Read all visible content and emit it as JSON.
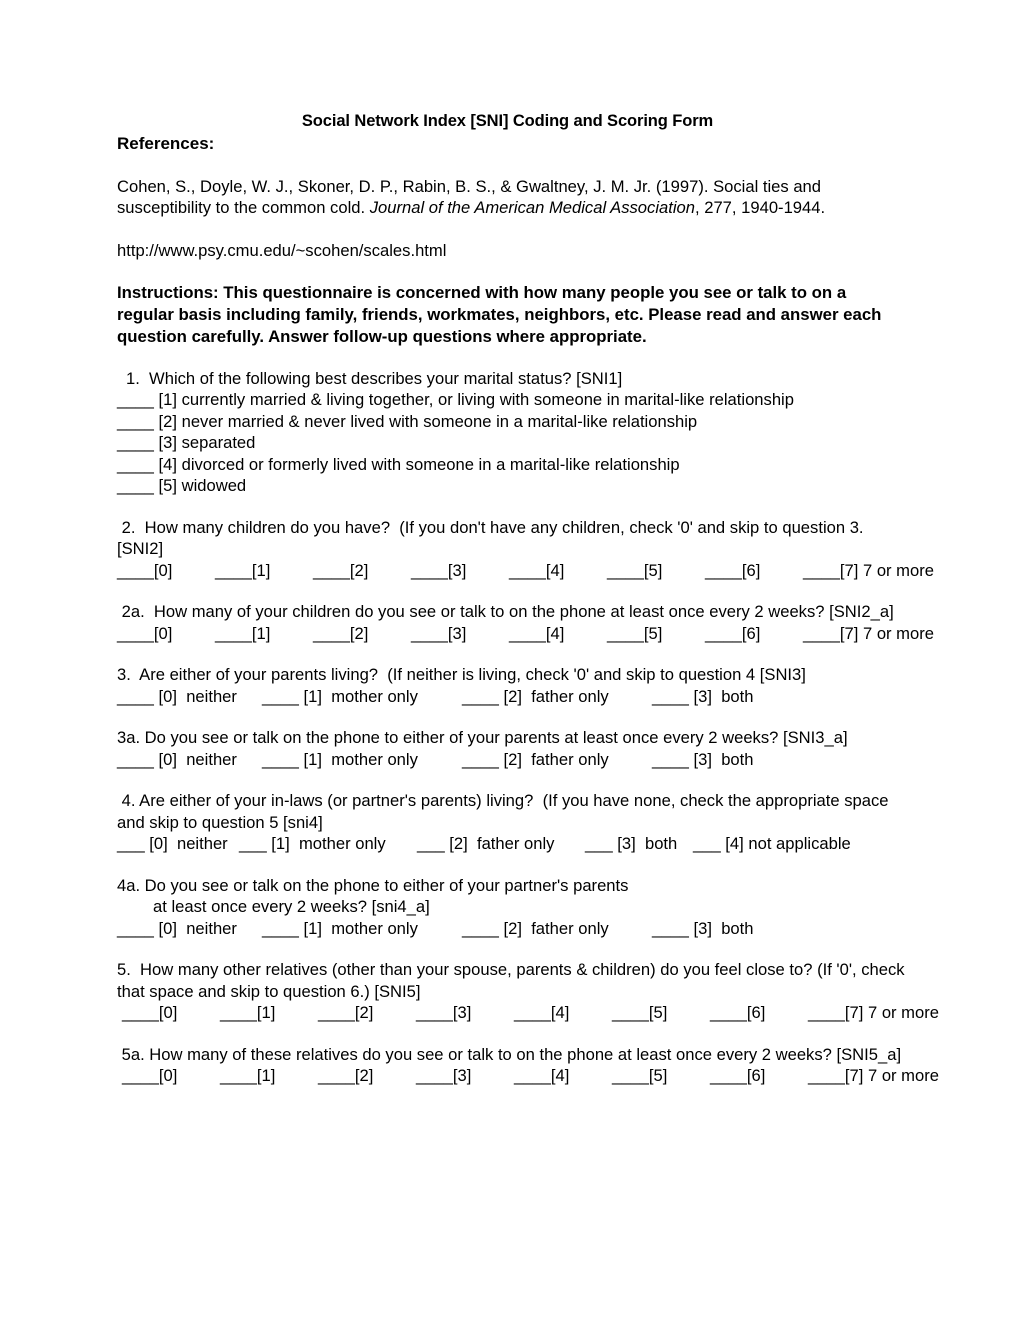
{
  "document": {
    "title": "Social Network Index [SNI] Coding and Scoring Form",
    "references_label": "References:",
    "citation_part1": "Cohen, S., Doyle, W. J., Skoner, D. P., Rabin, B. S., & Gwaltney, J. M. Jr. (1997). Social ties and susceptibility to the common cold. ",
    "citation_journal": "Journal of the American Medical Association",
    "citation_part2": ", 277, 1940-1944.",
    "url": "http://www.psy.cmu.edu/~scohen/scales.html",
    "instructions": "Instructions:  This questionnaire is concerned with how many people you see or talk to on a regular basis including family, friends, workmates, neighbors, etc.  Please read and answer each question carefully.  Answer follow-up questions where appropriate."
  },
  "questions": {
    "q1": {
      "text": "1.  Which of the following best describes your marital status? [SNI1]",
      "options": [
        "____ [1] currently married & living together, or living with someone in marital-like relationship",
        "____ [2] never married & never lived with someone in a marital-like relationship",
        "____ [3] separated",
        "____ [4] divorced or formerly lived with someone in a marital-like relationship",
        "____ [5] widowed"
      ]
    },
    "q2": {
      "text": " 2.  How many children do you have?  (If you don't have any children, check '0' and skip to question 3. [SNI2]",
      "scale": [
        "____[0]",
        "____[1]",
        "____[2]",
        "____[3]",
        "____[4]",
        "____[5]",
        "____[6]",
        "____[7] 7 or more"
      ]
    },
    "q2a": {
      "text": " 2a.  How many of your children do you see or talk to on the phone at least once every 2 weeks? [SNI2_a]",
      "scale": [
        "____[0]",
        "____[1]",
        "____[2]",
        "____[3]",
        "____[4]",
        "____[5]",
        "____[6]",
        "____[7] 7 or more"
      ]
    },
    "q3": {
      "text": "3.  Are either of your parents living?  (If neither is living, check '0' and skip to question 4 [SNI3]",
      "options": [
        "____ [0]  neither",
        "____ [1]  mother only",
        "____ [2]  father only",
        "____ [3]  both"
      ]
    },
    "q3a": {
      "text": "3a. Do you see or talk on the phone to either of your parents at least once every 2 weeks? [SNI3_a]",
      "options": [
        "____ [0]  neither",
        "____ [1]  mother only",
        "____ [2]  father only",
        "____ [3]  both"
      ]
    },
    "q4": {
      "text": " 4. Are either of your in-laws (or partner's parents) living?  (If you have none, check the appropriate space and skip to question 5 [sni4]",
      "options": [
        "___ [0]  neither",
        "___ [1]  mother only",
        "___ [2]  father only",
        "___ [3]  both",
        "___ [4] not applicable"
      ]
    },
    "q4a": {
      "text_line1": "4a. Do you see or talk on the phone to either of your partner's parents",
      "text_line2": "at least once every 2 weeks? [sni4_a]",
      "options": [
        "____ [0]  neither",
        "____ [1]  mother only",
        "____ [2]  father only",
        "____ [3]  both"
      ]
    },
    "q5": {
      "text": "5.  How many other relatives (other than your spouse, parents & children) do you feel close to? (If '0', check that space and skip to question 6.) [SNI5]",
      "scale": [
        "____[0]",
        "____[1]",
        "____[2]",
        "____[3]",
        "____[4]",
        "____[5]",
        "____[6]",
        "____[7] 7 or more"
      ]
    },
    "q5a": {
      "text": " 5a. How many of these relatives do you see or talk to on the phone at least once every 2 weeks? [SNI5_a]",
      "scale": [
        "____[0]",
        "____[1]",
        "____[2]",
        "____[3]",
        "____[4]",
        "____[5]",
        "____[6]",
        "____[7] 7 or more"
      ]
    }
  }
}
